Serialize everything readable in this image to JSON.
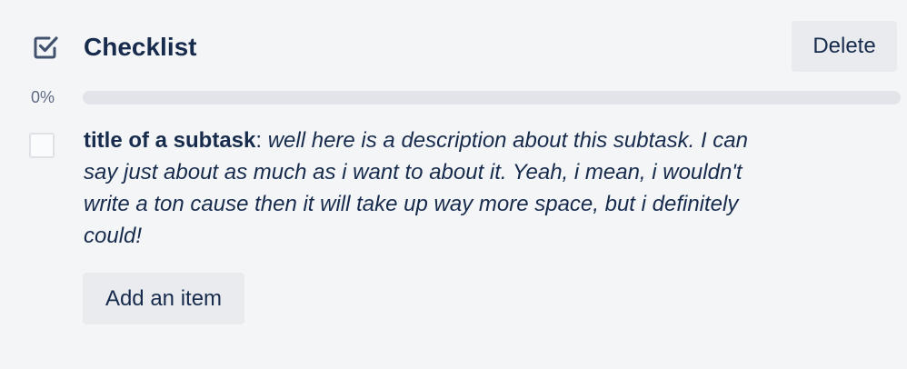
{
  "checklist": {
    "title": "Checklist",
    "delete_label": "Delete",
    "progress_text": "0%",
    "progress_value": 0,
    "icon": "checkbox-checked-icon",
    "add_item_label": "Add an item",
    "items": [
      {
        "title": "title of a subtask",
        "separator": ": ",
        "description": "well here is a description about this subtask. I can say just about as much as i want to about it. Yeah, i mean, i wouldn't write a ton cause then it will take up way more space, but i definitely could!",
        "checked": false
      }
    ]
  },
  "colors": {
    "background": "#f4f5f7",
    "text": "#172b4d",
    "muted_text": "#5e6c84",
    "button_bg": "#e9ebee",
    "progress_track": "#e2e4e9"
  }
}
